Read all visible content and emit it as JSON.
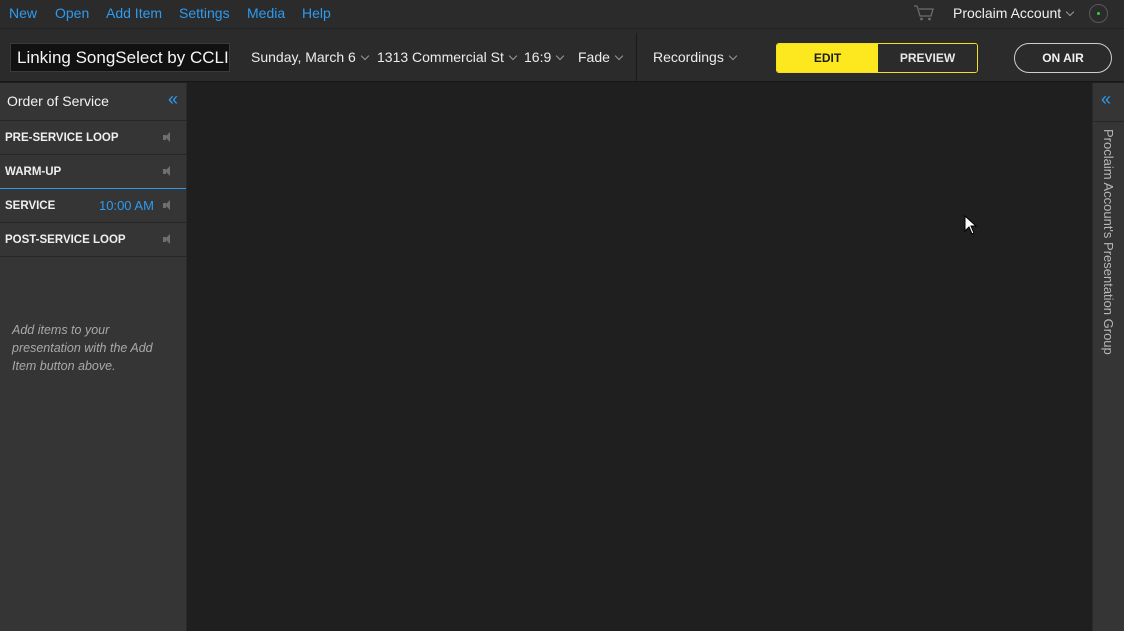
{
  "menu": {
    "new_label": "New",
    "open_label": "Open",
    "add_item_label": "Add Item",
    "settings_label": "Settings",
    "media_label": "Media",
    "help_label": "Help"
  },
  "header": {
    "cart_icon": "cart-icon",
    "account_label": "Proclaim Account",
    "status_icon": "online-status-icon"
  },
  "toolbar": {
    "presentation_title": "Linking SongSelect by CCLI",
    "date_label": "Sunday, March 6",
    "location_label": "1313 Commercial St",
    "aspect_label": "16:9",
    "transition_label": "Fade",
    "recordings_label": "Recordings",
    "edit_label": "EDIT",
    "preview_label": "PREVIEW",
    "on_air_label": "ON AIR",
    "accent_color": "#fde820"
  },
  "sidebar": {
    "title": "Order of Service",
    "collapse_icon": "double-chevron-left-icon",
    "sections": [
      {
        "label": "PRE-SERVICE LOOP",
        "time": ""
      },
      {
        "label": "WARM-UP",
        "time": ""
      },
      {
        "label": "SERVICE",
        "time": "10:00 AM"
      },
      {
        "label": "POST-SERVICE LOOP",
        "time": ""
      }
    ],
    "empty_hint": "Add items to your presentation with the Add Item button above."
  },
  "right_panel": {
    "expand_icon": "double-chevron-left-icon",
    "label": "Proclaim Account's Presentation Group"
  },
  "colors": {
    "link_blue": "#2e9bf0",
    "panel_bg": "#353535",
    "canvas_bg": "#1f1f1f"
  }
}
